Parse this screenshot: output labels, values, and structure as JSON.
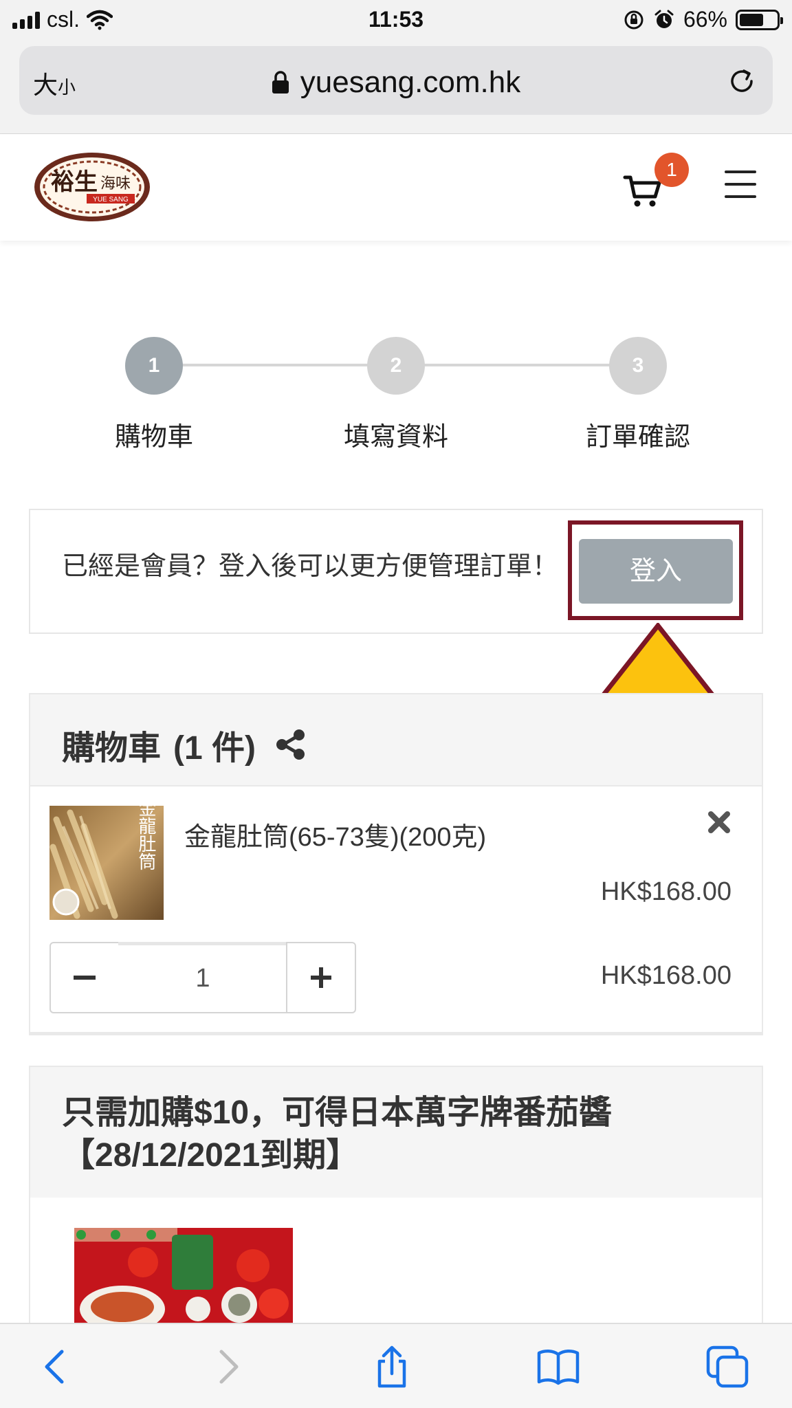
{
  "status_bar": {
    "carrier": "csl.",
    "time": "11:53",
    "battery": "66%",
    "battery_level": 0.66
  },
  "browser": {
    "text_size_label": "大",
    "text_size_small": "小",
    "url": "yuesang.com.hk"
  },
  "header": {
    "cart_count": "1"
  },
  "stepper": {
    "steps": [
      {
        "number": "1",
        "label": "購物車",
        "active": true
      },
      {
        "number": "2",
        "label": "填寫資料",
        "active": false
      },
      {
        "number": "3",
        "label": "訂單確認",
        "active": false
      }
    ]
  },
  "login": {
    "prompt": "已經是會員？登入後可以更方便管理訂單！",
    "button_label": "登入"
  },
  "cart": {
    "title": "購物車",
    "count_label": "(1 件)",
    "items": [
      {
        "name": "金龍肚筒(65-73隻)(200克)",
        "unit_price": "HK$168.00",
        "quantity": "1",
        "line_total": "HK$168.00",
        "image_text": "金龍肚筒"
      }
    ]
  },
  "promo": {
    "title": "只需加購$10，可得日本萬字牌番茄醬【28/12/2021到期】"
  },
  "colors": {
    "step_active": "#9ea7ad",
    "step_inactive": "#d3d3d3",
    "badge": "#e2552b",
    "highlight": "#7b1626",
    "arrow_fill": "#fcc20e"
  }
}
